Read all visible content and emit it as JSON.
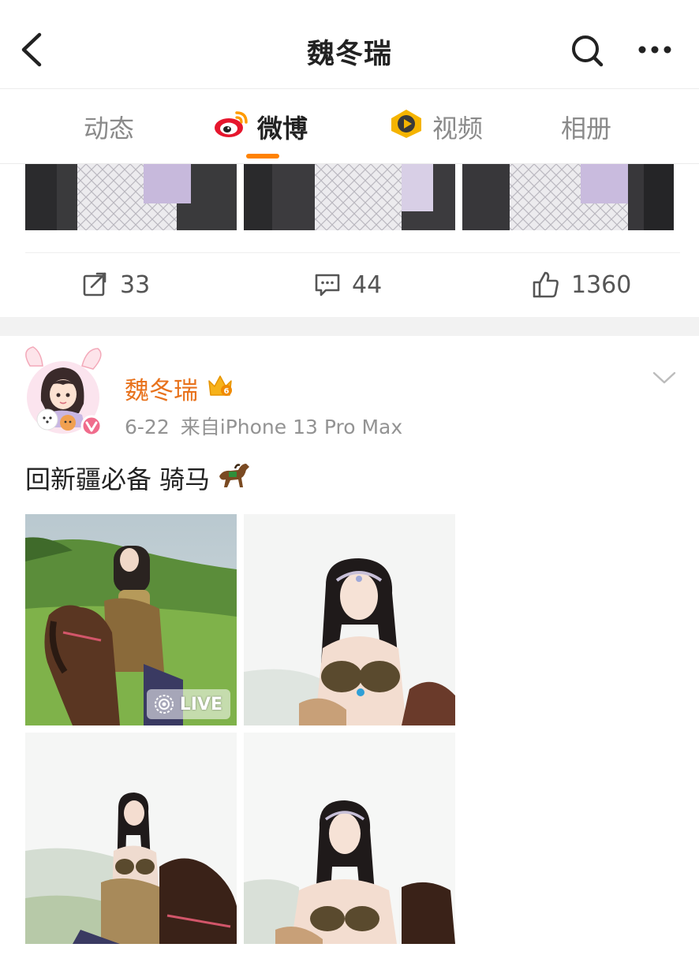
{
  "header": {
    "title": "魏冬瑞"
  },
  "tabs": [
    {
      "label": "动态"
    },
    {
      "label": "微博"
    },
    {
      "label": "视频"
    },
    {
      "label": "相册"
    }
  ],
  "prev_post": {
    "repost_count": "33",
    "comment_count": "44",
    "like_count": "1360"
  },
  "post": {
    "author": "魏冬瑞",
    "date": "6-22",
    "source": "来自iPhone 13 Pro Max",
    "text": "回新疆必备 骑马",
    "live_label": "LIVE"
  },
  "colors": {
    "accent": "#ff8200",
    "author_name": "#e8721c",
    "meta_text": "#939393"
  },
  "icons": [
    "back-icon",
    "search-icon",
    "more-icon",
    "weibo-logo-icon",
    "video-icon",
    "repost-icon",
    "comment-icon",
    "like-icon",
    "crown-icon",
    "chevron-down-icon",
    "horse-emoji-icon",
    "live-icon"
  ]
}
